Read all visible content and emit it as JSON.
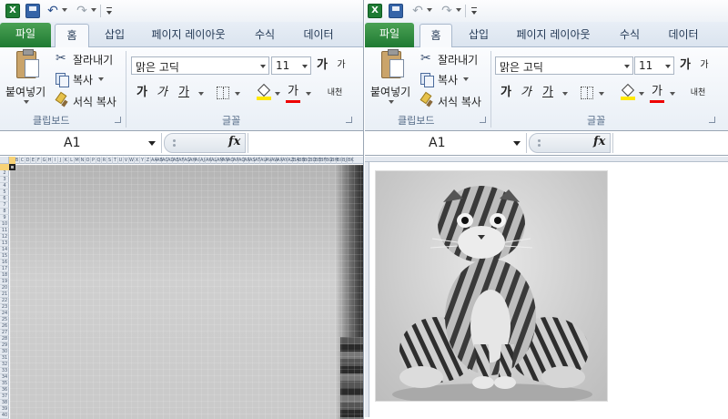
{
  "quick_access": {
    "excel_icon_letter": "X",
    "icons": [
      "excel-icon",
      "save-icon",
      "undo-icon",
      "redo-icon",
      "customize-qat-icon"
    ]
  },
  "tabs": [
    {
      "label": "파일"
    },
    {
      "label": "홈"
    },
    {
      "label": "삽입"
    },
    {
      "label": "페이지 레이아웃"
    },
    {
      "label": "수식"
    },
    {
      "label": "데이터"
    }
  ],
  "clipboard": {
    "paste_label": "붙여넣기",
    "cut_label": "잘라내기",
    "copy_label": "복사",
    "format_painter_label": "서식 복사",
    "group_label": "클립보드"
  },
  "font": {
    "family": "맑은 고딕",
    "size": "11",
    "grow_label": "가",
    "shrink_label": "가",
    "bold_label": "가",
    "italic_label": "가",
    "underline_label": "가",
    "color_label": "가",
    "phonetic_label": "내천",
    "group_label": "글꼴"
  },
  "formula_bar": {
    "name_box": "A1",
    "fx_label": "fx",
    "value": ""
  },
  "sheet": {
    "columns": [
      "A",
      "B",
      "C",
      "D",
      "E",
      "F",
      "G",
      "H",
      "I",
      "J",
      "K",
      "L",
      "M",
      "N",
      "O",
      "P",
      "Q",
      "R",
      "S",
      "T",
      "U",
      "V",
      "W",
      "X",
      "Y",
      "Z",
      "AA",
      "AB",
      "AC",
      "AD",
      "AE",
      "AF",
      "AG",
      "AH",
      "AI",
      "AJ",
      "AK",
      "AL",
      "AM",
      "AN",
      "AO",
      "AP",
      "AQ",
      "AR",
      "AS",
      "AT",
      "AU",
      "AV",
      "AW",
      "AX",
      "AY",
      "AZ",
      "BA",
      "BB",
      "BC",
      "BD",
      "BE",
      "BF",
      "BG",
      "BH",
      "BI",
      "BJ",
      "BK"
    ],
    "rows": [
      "1",
      "2",
      "3",
      "4",
      "5",
      "6",
      "7",
      "8",
      "9",
      "10",
      "11",
      "12",
      "13",
      "14",
      "15",
      "16",
      "17",
      "18",
      "19",
      "20",
      "21",
      "22",
      "23",
      "24",
      "25",
      "26",
      "27",
      "28",
      "29",
      "30",
      "31",
      "32",
      "33",
      "34",
      "35",
      "36",
      "37",
      "38",
      "39",
      "40"
    ],
    "active_cell": "A1"
  },
  "colors": {
    "file_tab": "#2a8a3e",
    "ribbon_bg": "#f0f4f9",
    "header_bg": "#e4e9f0",
    "font_color_bar": "#e00000",
    "fill_color_bar": "#ffe800"
  }
}
